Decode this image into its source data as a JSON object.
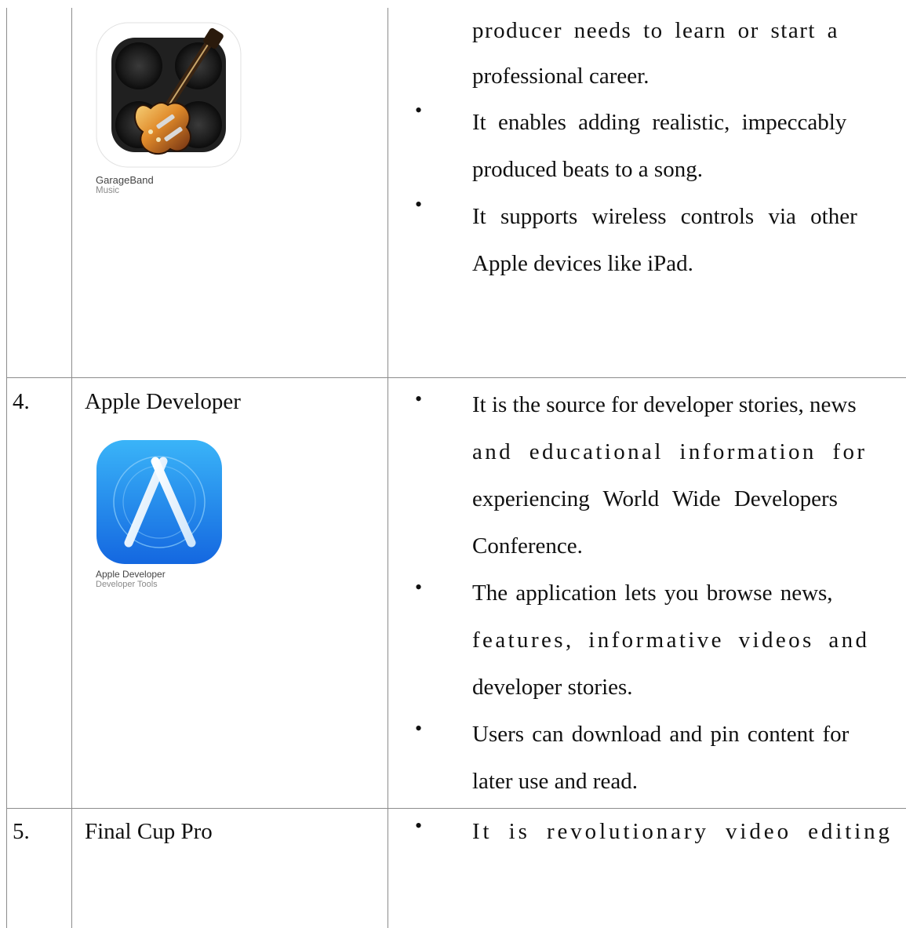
{
  "rows": [
    {
      "number": "",
      "app_title": "",
      "app_tile": {
        "name": "GarageBand",
        "category": "Music",
        "icon": "garageband-guitar-icon"
      },
      "bullets": [
        {
          "lines": [
            "producer needs to learn or start a",
            "professional career."
          ],
          "continuation": true
        },
        {
          "lines": [
            "It enables adding realistic, impeccably",
            "produced beats to a song."
          ]
        },
        {
          "lines": [
            "It supports wireless controls via other",
            "Apple devices like iPad."
          ]
        }
      ]
    },
    {
      "number": "4.",
      "app_title": "Apple Developer",
      "app_tile": {
        "name": "Apple Developer",
        "category": "Developer Tools",
        "icon": "apple-developer-a-icon"
      },
      "bullets": [
        {
          "lines": [
            "It is the source for developer stories, news",
            "and educational information for",
            "experiencing World Wide Developers",
            "Conference."
          ]
        },
        {
          "lines": [
            "The application lets you browse news,",
            "features, informative videos and",
            "developer stories."
          ]
        },
        {
          "lines": [
            "Users can download and pin content for",
            "later use and read."
          ]
        }
      ]
    },
    {
      "number": "5.",
      "app_title": "Final Cup Pro",
      "bullets": [
        {
          "lines": [
            "It is revolutionary video editing"
          ]
        }
      ]
    }
  ],
  "colors": {
    "border": "#8c8c8c",
    "text": "#111111",
    "app_blue": "#1f8fef"
  }
}
